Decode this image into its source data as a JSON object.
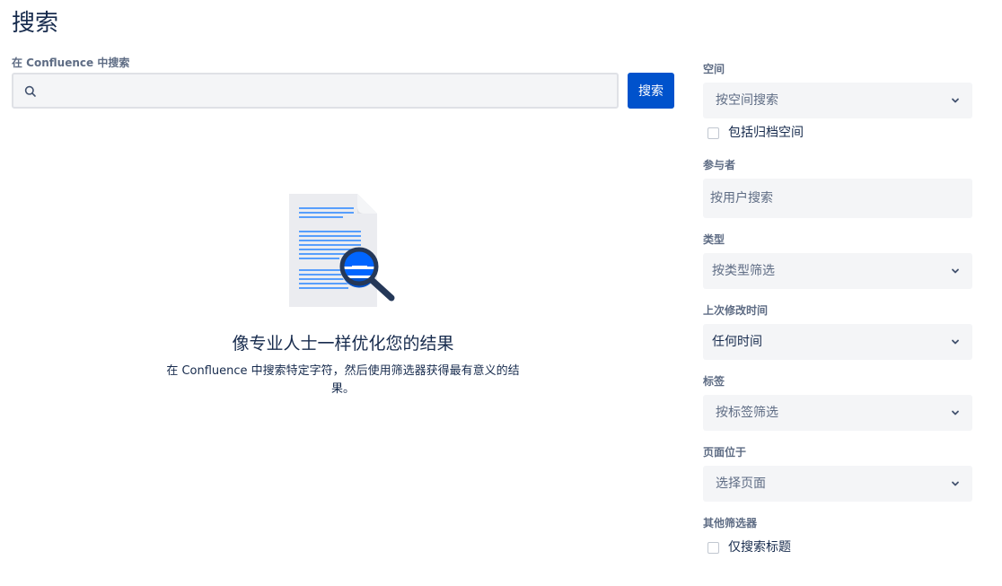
{
  "page": {
    "title": "搜索"
  },
  "search": {
    "label": "在 Confluence 中搜索",
    "value": "",
    "placeholder": "",
    "button_label": "搜索"
  },
  "empty_state": {
    "heading": "像专业人士一样优化您的结果",
    "description": "在 Confluence 中搜索特定字符，然后使用筛选器获得最有意义的结果。"
  },
  "filters": {
    "space": {
      "label": "空间",
      "value": "按空间搜索",
      "archived_checkbox_label": "包括归档空间",
      "archived_checked": false
    },
    "contributor": {
      "label": "参与者",
      "placeholder": "按用户搜索"
    },
    "type": {
      "label": "类型",
      "value": "按类型筛选"
    },
    "last_modified": {
      "label": "上次修改时间",
      "value": "任何时间"
    },
    "label_filter": {
      "label": "标签",
      "value": "按标签筛选"
    },
    "ancestor": {
      "label": "页面位于",
      "value": "选择页面"
    },
    "other": {
      "label": "其他筛选器",
      "title_only_label": "仅搜索标题",
      "title_only_checked": false
    }
  },
  "colors": {
    "primary": "#0052cc",
    "text": "#172b4d",
    "subtle_text": "#5e6c84",
    "field_bg": "#f4f5f7"
  },
  "icons": {
    "search": "search-icon",
    "chevron": "chevron-down-icon",
    "illustration": "document-search-illustration"
  }
}
